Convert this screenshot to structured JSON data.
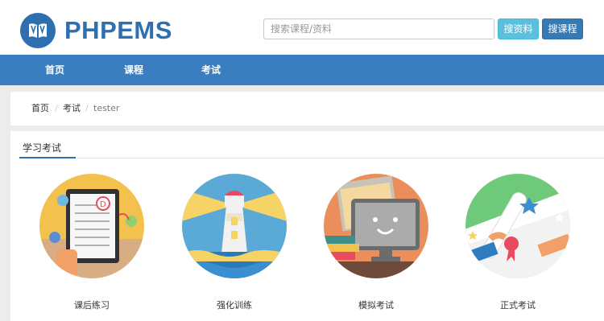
{
  "brand": {
    "name": "PHPEMS",
    "color": "#2e6fb0",
    "logo_icon": "open-book-icon"
  },
  "search": {
    "placeholder": "搜索课程/资料",
    "value": ""
  },
  "buttons": {
    "search_material": "搜资料",
    "search_course": "搜课程"
  },
  "nav": {
    "items": [
      {
        "label": "首页"
      },
      {
        "label": "课程"
      },
      {
        "label": "考试"
      }
    ],
    "bg_color": "#3a7ebf"
  },
  "breadcrumb": {
    "items": [
      "首页",
      "考试",
      "tester"
    ],
    "separator": "/"
  },
  "panel": {
    "title": "学习考试"
  },
  "cards": [
    {
      "label": "课后练习",
      "icon": "tablet-quiz-icon"
    },
    {
      "label": "强化训练",
      "icon": "lighthouse-icon"
    },
    {
      "label": "模拟考试",
      "icon": "monitor-books-icon"
    },
    {
      "label": "正式考试",
      "icon": "diploma-scroll-icon"
    }
  ]
}
